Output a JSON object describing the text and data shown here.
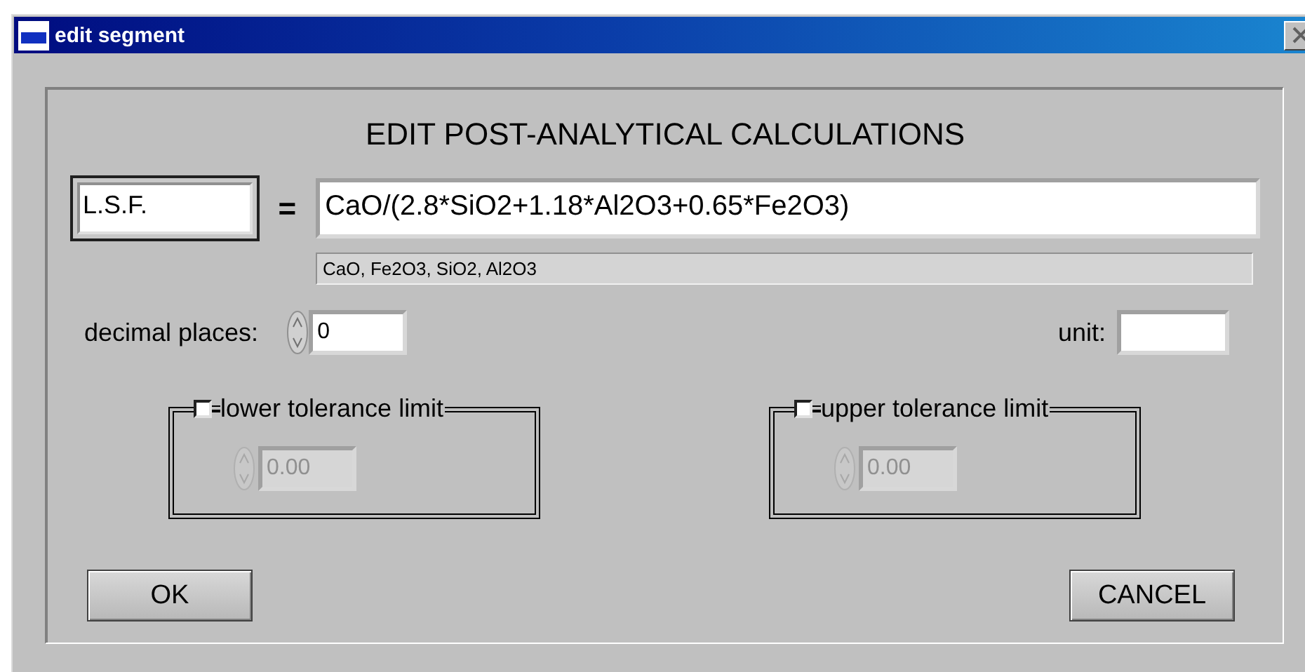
{
  "window": {
    "title": "edit segment"
  },
  "heading": "EDIT POST-ANALYTICAL CALCULATIONS",
  "calculation": {
    "name": "L.S.F.",
    "equals": "=",
    "formula": "CaO/(2.8*SiO2+1.18*Al2O3+0.65*Fe2O3)",
    "variables": "CaO, Fe2O3, SiO2, Al2O3"
  },
  "decimal_places": {
    "label": "decimal places:",
    "value": "0"
  },
  "unit": {
    "label": "unit:"
  },
  "tolerances": [
    {
      "label": "lower tolerance limit",
      "checked": false,
      "disabled": true,
      "value": "0.00"
    },
    {
      "label": "upper tolerance limit",
      "checked": false,
      "disabled": true,
      "value": "0.00"
    }
  ],
  "buttons": [
    {
      "label": "OK"
    },
    {
      "label": "CANCEL"
    }
  ]
}
